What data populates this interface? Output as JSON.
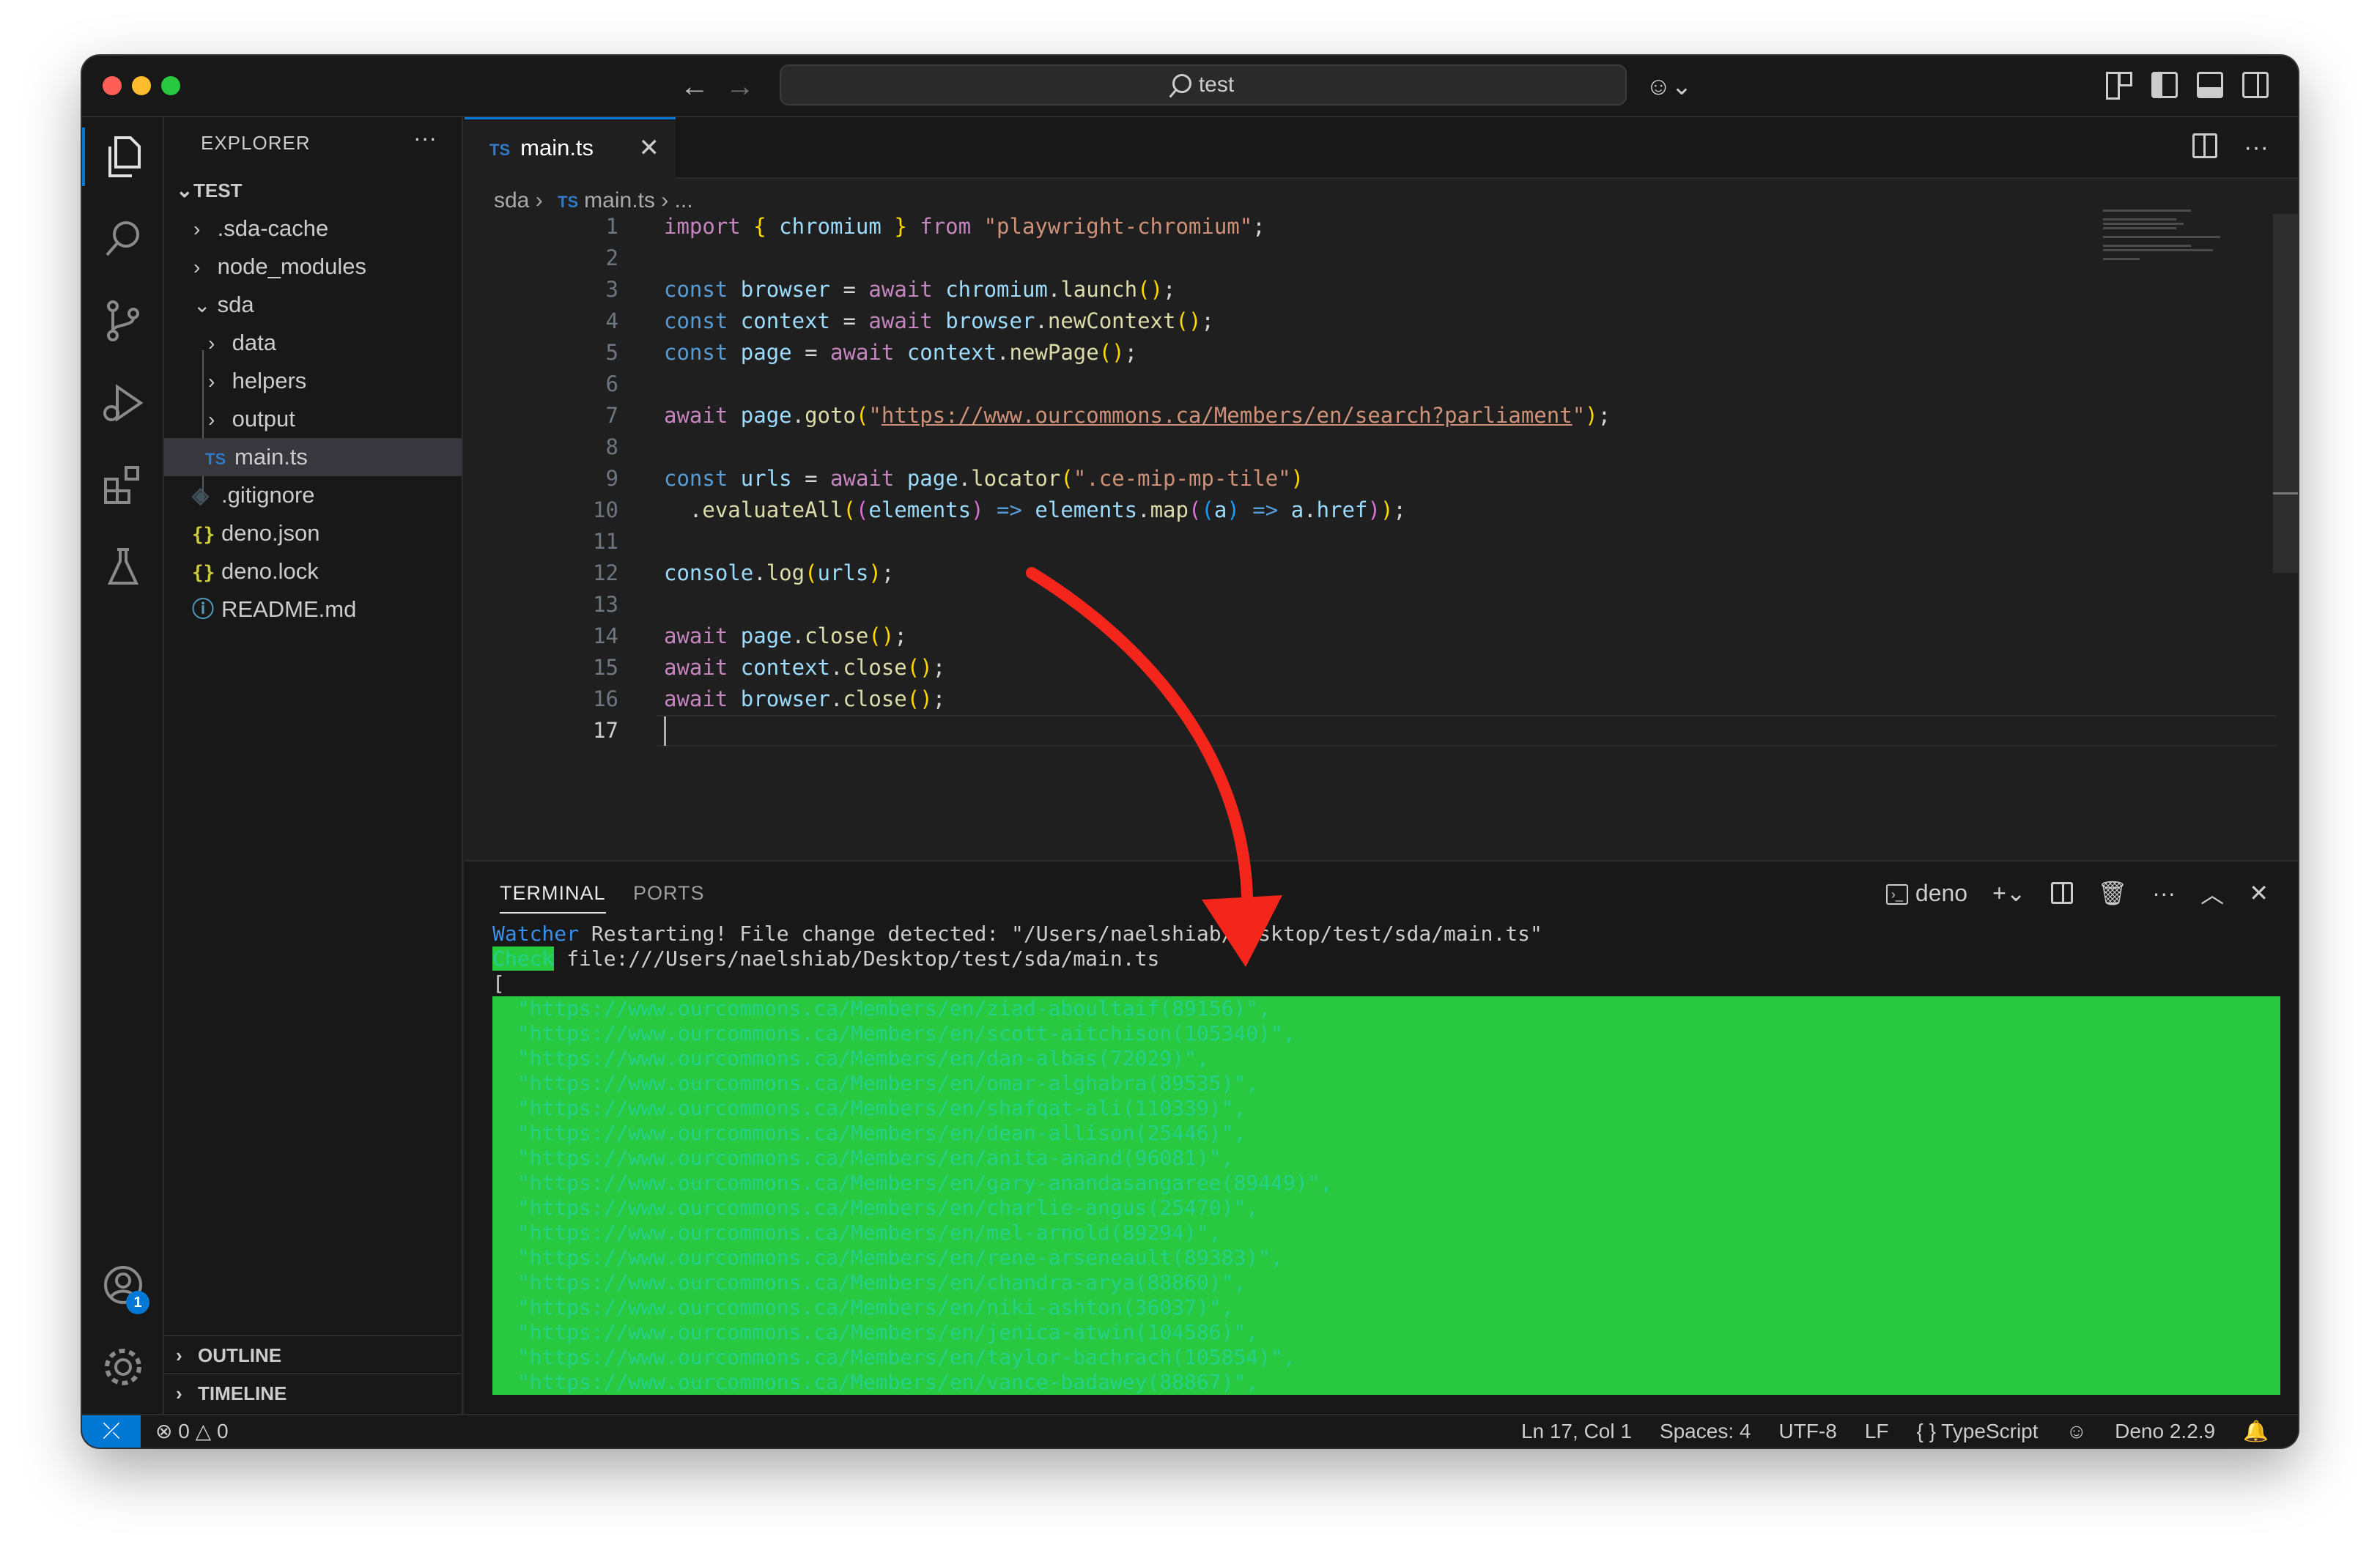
{
  "window": {
    "search_text": "test",
    "nav_back": "←",
    "nav_forward": "→"
  },
  "activity": {
    "account_badge": "1"
  },
  "explorer": {
    "title": "EXPLORER",
    "more": "···",
    "root": "TEST",
    "items": [
      {
        "label": ".sda-cache",
        "kind": "folder"
      },
      {
        "label": "node_modules",
        "kind": "folder"
      },
      {
        "label": "sda",
        "kind": "folder-open"
      },
      {
        "label": "data",
        "kind": "folder"
      },
      {
        "label": "helpers",
        "kind": "folder"
      },
      {
        "label": "output",
        "kind": "folder"
      },
      {
        "label": "main.ts",
        "kind": "ts"
      },
      {
        "label": ".gitignore",
        "kind": "git"
      },
      {
        "label": "deno.json",
        "kind": "json"
      },
      {
        "label": "deno.lock",
        "kind": "json"
      },
      {
        "label": "README.md",
        "kind": "info"
      }
    ],
    "outline": "OUTLINE",
    "timeline": "TIMELINE"
  },
  "editor": {
    "tab_label": "main.ts",
    "tab_badge": "TS",
    "breadcrumb": {
      "folder": "sda",
      "file": "main.ts",
      "tail": "..."
    },
    "line_numbers": [
      "1",
      "2",
      "3",
      "4",
      "5",
      "6",
      "7",
      "8",
      "9",
      "10",
      "11",
      "12",
      "13",
      "14",
      "15",
      "16",
      "17"
    ],
    "code": [
      "import { chromium } from \"playwright-chromium\";",
      "",
      "const browser = await chromium.launch();",
      "const context = await browser.newContext();",
      "const page = await context.newPage();",
      "",
      "await page.goto(\"https://www.ourcommons.ca/Members/en/search?parliament\");",
      "",
      "const urls = await page.locator(\".ce-mip-mp-tile\")",
      "  .evaluateAll((elements) => elements.map((a) => a.href));",
      "",
      "console.log(urls);",
      "",
      "await page.close();",
      "await context.close();",
      "await browser.close();",
      ""
    ],
    "current_line": "17"
  },
  "panel": {
    "tab_terminal": "TERMINAL",
    "tab_ports": "PORTS",
    "shell_name": "deno",
    "output": {
      "watcher_label": "Watcher",
      "watcher_msg": " Restarting! File change detected: \"/Users/naelshiab/Desktop/test/sda/main.ts\"",
      "check_label": "Check",
      "check_msg": " file:///Users/naelshiab/Desktop/test/sda/main.ts",
      "open_bracket": "[",
      "urls": [
        "  \"https://www.ourcommons.ca/Members/en/ziad-aboultaif(89156)\",",
        "  \"https://www.ourcommons.ca/Members/en/scott-aitchison(105340)\",",
        "  \"https://www.ourcommons.ca/Members/en/dan-albas(72029)\",",
        "  \"https://www.ourcommons.ca/Members/en/omar-alghabra(89535)\",",
        "  \"https://www.ourcommons.ca/Members/en/shafqat-ali(110339)\",",
        "  \"https://www.ourcommons.ca/Members/en/dean-allison(25446)\",",
        "  \"https://www.ourcommons.ca/Members/en/anita-anand(96081)\",",
        "  \"https://www.ourcommons.ca/Members/en/gary-anandasangaree(89449)\",",
        "  \"https://www.ourcommons.ca/Members/en/charlie-angus(25470)\",",
        "  \"https://www.ourcommons.ca/Members/en/mel-arnold(89294)\",",
        "  \"https://www.ourcommons.ca/Members/en/rene-arseneault(89383)\",",
        "  \"https://www.ourcommons.ca/Members/en/chandra-arya(88860)\",",
        "  \"https://www.ourcommons.ca/Members/en/niki-ashton(36037)\",",
        "  \"https://www.ourcommons.ca/Members/en/jenica-atwin(104586)\",",
        "  \"https://www.ourcommons.ca/Members/en/taylor-bachrach(105854)\",",
        "  \"https://www.ourcommons.ca/Members/en/vance-badawey(88867)\","
      ]
    }
  },
  "status": {
    "errors": "0",
    "warnings": "0",
    "position": "Ln 17, Col 1",
    "spaces": "Spaces: 4",
    "encoding": "UTF-8",
    "eol": "LF",
    "language": "TypeScript",
    "deno_version": "Deno 2.2.9"
  },
  "colors": {
    "accent": "#0078d4",
    "annotation_arrow": "#f4261c",
    "terminal_green": "#23d18b",
    "terminal_blue": "#3b8eea"
  }
}
